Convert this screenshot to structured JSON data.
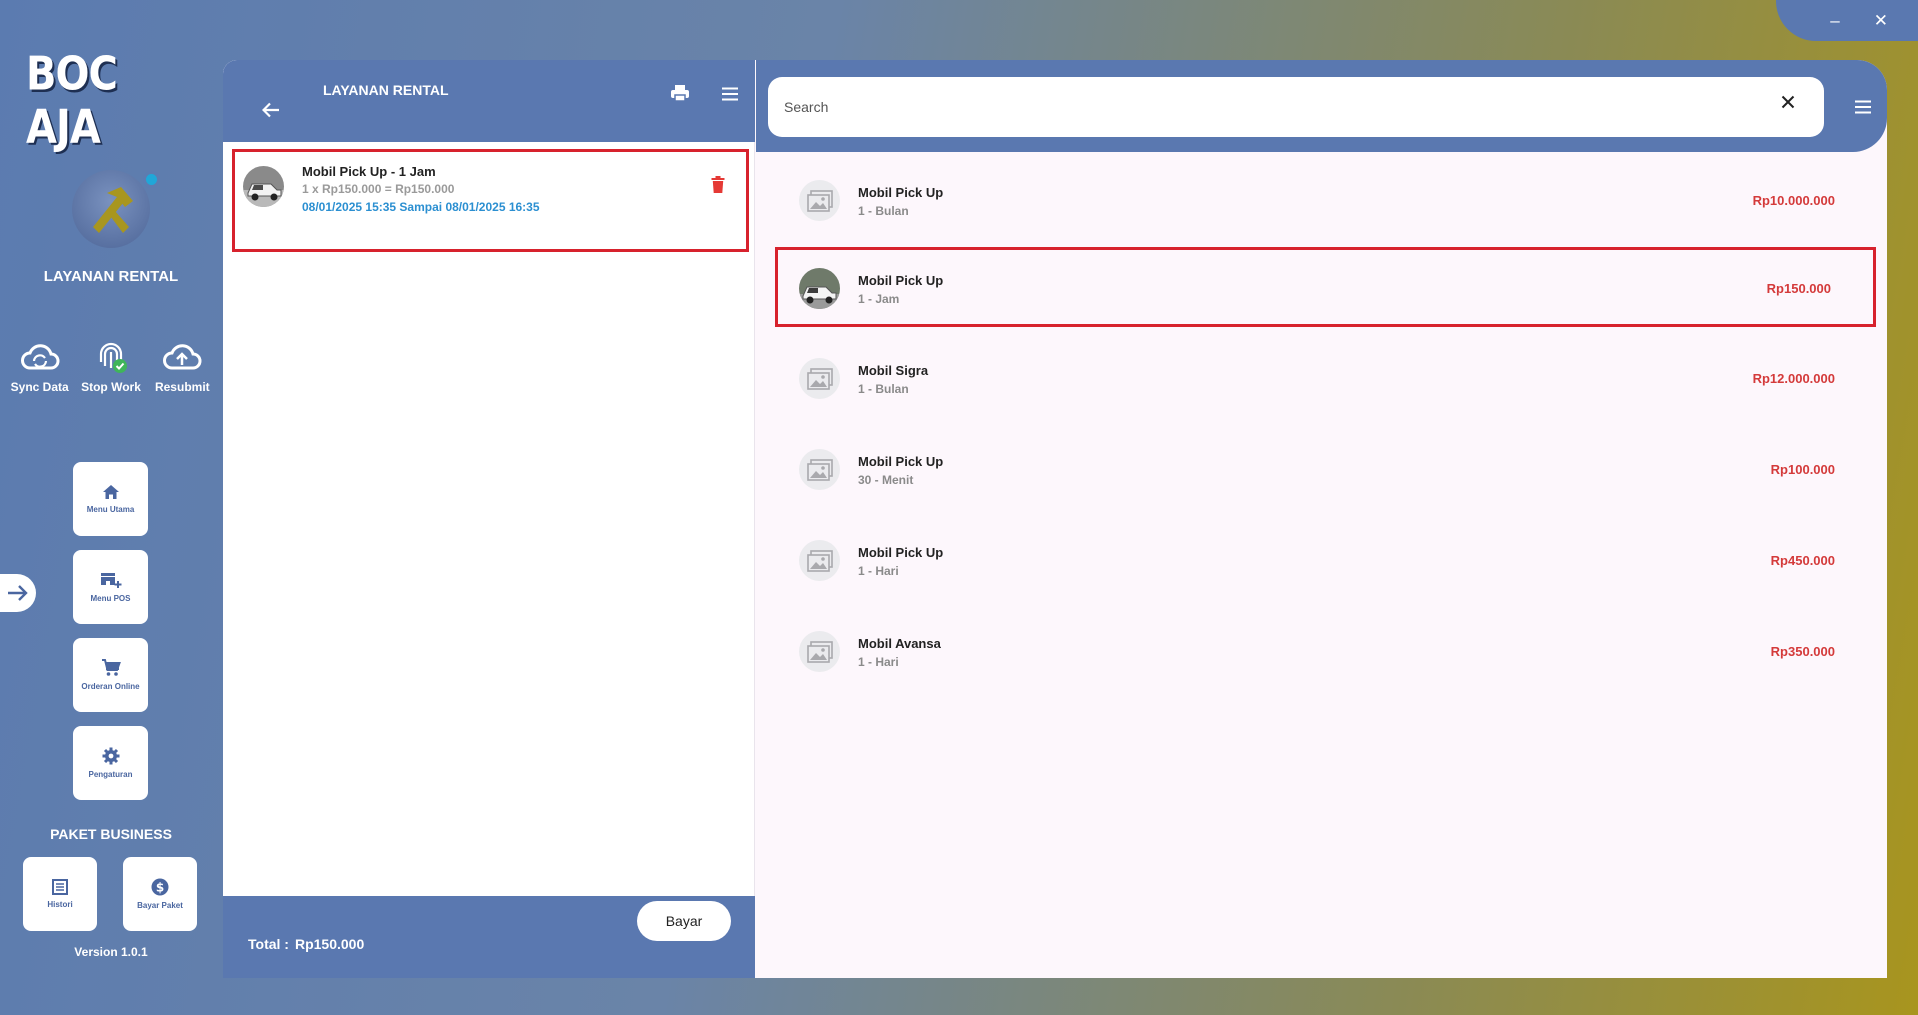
{
  "window": {
    "minimize": "–",
    "close": "✕"
  },
  "sidebar": {
    "logo_text": "BOC AJA",
    "brand_name": "LAYANAN RENTAL",
    "quick_actions": [
      {
        "label": "Sync Data",
        "icon": "sync-cloud-icon"
      },
      {
        "label": "Stop Work",
        "icon": "fingerprint-icon"
      },
      {
        "label": "Resubmit",
        "icon": "cloud-upload-icon"
      }
    ],
    "nav": [
      {
        "label": "Menu Utama",
        "icon": "home-icon"
      },
      {
        "label": "Menu POS",
        "icon": "store-add-icon"
      },
      {
        "label": "Orderan Online",
        "icon": "cart-icon"
      },
      {
        "label": "Pengaturan",
        "icon": "gear-icon"
      }
    ],
    "plan_title": "PAKET BUSINESS",
    "plan_buttons": [
      {
        "label": "Histori",
        "icon": "list-icon"
      },
      {
        "label": "Bayar Paket",
        "icon": "dollar-icon"
      }
    ],
    "version": "Version 1.0.1"
  },
  "cart": {
    "title": "LAYANAN RENTAL",
    "items": [
      {
        "name": "Mobil Pick Up - 1 Jam",
        "calc": "1 x Rp150.000 = Rp150.000",
        "period": "08/01/2025 15:35 Sampai 08/01/2025 16:35"
      }
    ],
    "total_label": "Total :",
    "total_value": "Rp150.000",
    "pay_label": "Bayar"
  },
  "search": {
    "placeholder": "Search",
    "value": ""
  },
  "products": [
    {
      "name": "Mobil Pick Up",
      "sub": "1 - Bulan",
      "price": "Rp10.000.000",
      "has_photo": false
    },
    {
      "name": "Mobil Pick Up",
      "sub": "1 - Jam",
      "price": "Rp150.000",
      "has_photo": true,
      "selected": true
    },
    {
      "name": "Mobil Sigra",
      "sub": "1 - Bulan",
      "price": "Rp12.000.000",
      "has_photo": false
    },
    {
      "name": "Mobil Pick Up",
      "sub": "30 - Menit",
      "price": "Rp100.000",
      "has_photo": false
    },
    {
      "name": "Mobil Pick Up",
      "sub": "1 - Hari",
      "price": "Rp450.000",
      "has_photo": false
    },
    {
      "name": "Mobil Avansa",
      "sub": "1 - Hari",
      "price": "Rp350.000",
      "has_photo": false
    }
  ],
  "colors": {
    "primary": "#5a78b0",
    "highlight": "#d7222d",
    "price": "#d43a3a",
    "period": "#2b8fd1"
  }
}
